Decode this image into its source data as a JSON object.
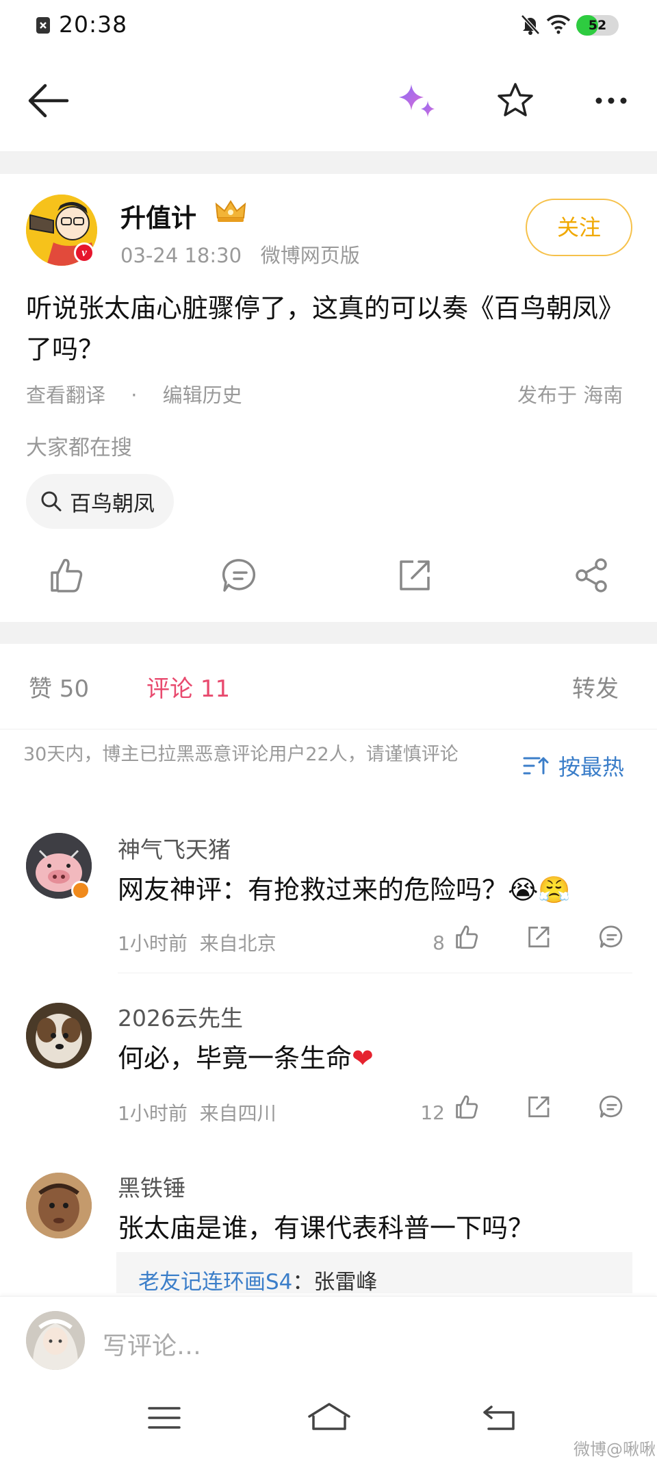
{
  "status_bar": {
    "time": "20:38",
    "battery": "52",
    "battery_level": 0.52
  },
  "nav": {
    "icons": [
      "back-arrow-icon",
      "ai-sparkle-icon",
      "star-outline-icon",
      "more-dots-icon"
    ]
  },
  "post": {
    "author": "升值计",
    "time": "03-24 18:30",
    "source": "微博网页版",
    "follow_label": "关注",
    "text": "听说张太庙心脏骤停了，这真的可以奏《百鸟朝凤》了吗？",
    "translate": "查看翻译",
    "dot": "·",
    "edit_history": "编辑历史",
    "location": "发布于 海南",
    "hot_search_label": "大家都在搜",
    "hot_search_term": "百鸟朝凤"
  },
  "tabs": {
    "likes": "赞 50",
    "comments": "评论 11",
    "reposts": "转发"
  },
  "notice": "30天内，博主已拉黑恶意评论用户22人，请谨慎评论",
  "sort_label": "按最热",
  "comments": [
    {
      "name": "神气飞天猪",
      "text": "网友神评：有抢救过来的危险吗？",
      "emoji": "😭😤",
      "time": "1小时前",
      "location": "来自北京",
      "likes": "8"
    },
    {
      "name": "2026云先生",
      "text": "何必，毕竟一条生命",
      "emoji": "❤",
      "time": "1小时前",
      "location": "来自四川",
      "likes": "12"
    },
    {
      "name": "黑铁锤",
      "text": "张太庙是谁，有课代表科普一下吗？"
    }
  ],
  "quote": {
    "link": "老友记连环画S4",
    "text": "：张雷峰"
  },
  "composer": {
    "placeholder": "写评论…"
  },
  "watermark": "微博@啾啾",
  "colors": {
    "accent_pink": "#e84a6e",
    "follow_yellow": "#f0a800",
    "link_blue": "#3b7ec9"
  }
}
